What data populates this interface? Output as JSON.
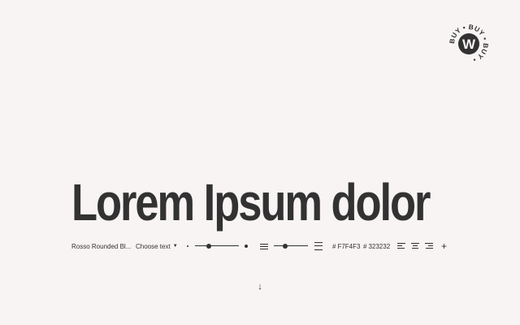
{
  "colors": {
    "background": "#f7f4f3",
    "foreground": "#323232"
  },
  "buy_badge": {
    "letter": "W",
    "ring_text": "BUY • BUY • BUY • "
  },
  "preview": {
    "text": "Lorem Ipsum dolor"
  },
  "toolbar": {
    "font_name": "Rosso Rounded Bl...",
    "choose_text": "Choose text",
    "caret_icon": "caret-down-icon",
    "font_size_level": 0.32,
    "line_height_level": 0.33,
    "background_color": "F7F4F3",
    "text_color": "323232",
    "hash": "#",
    "add_icon": "plus-icon",
    "plus": "+"
  },
  "scroll_hint": {
    "icon": "arrow-down-icon",
    "glyph": "↓"
  }
}
